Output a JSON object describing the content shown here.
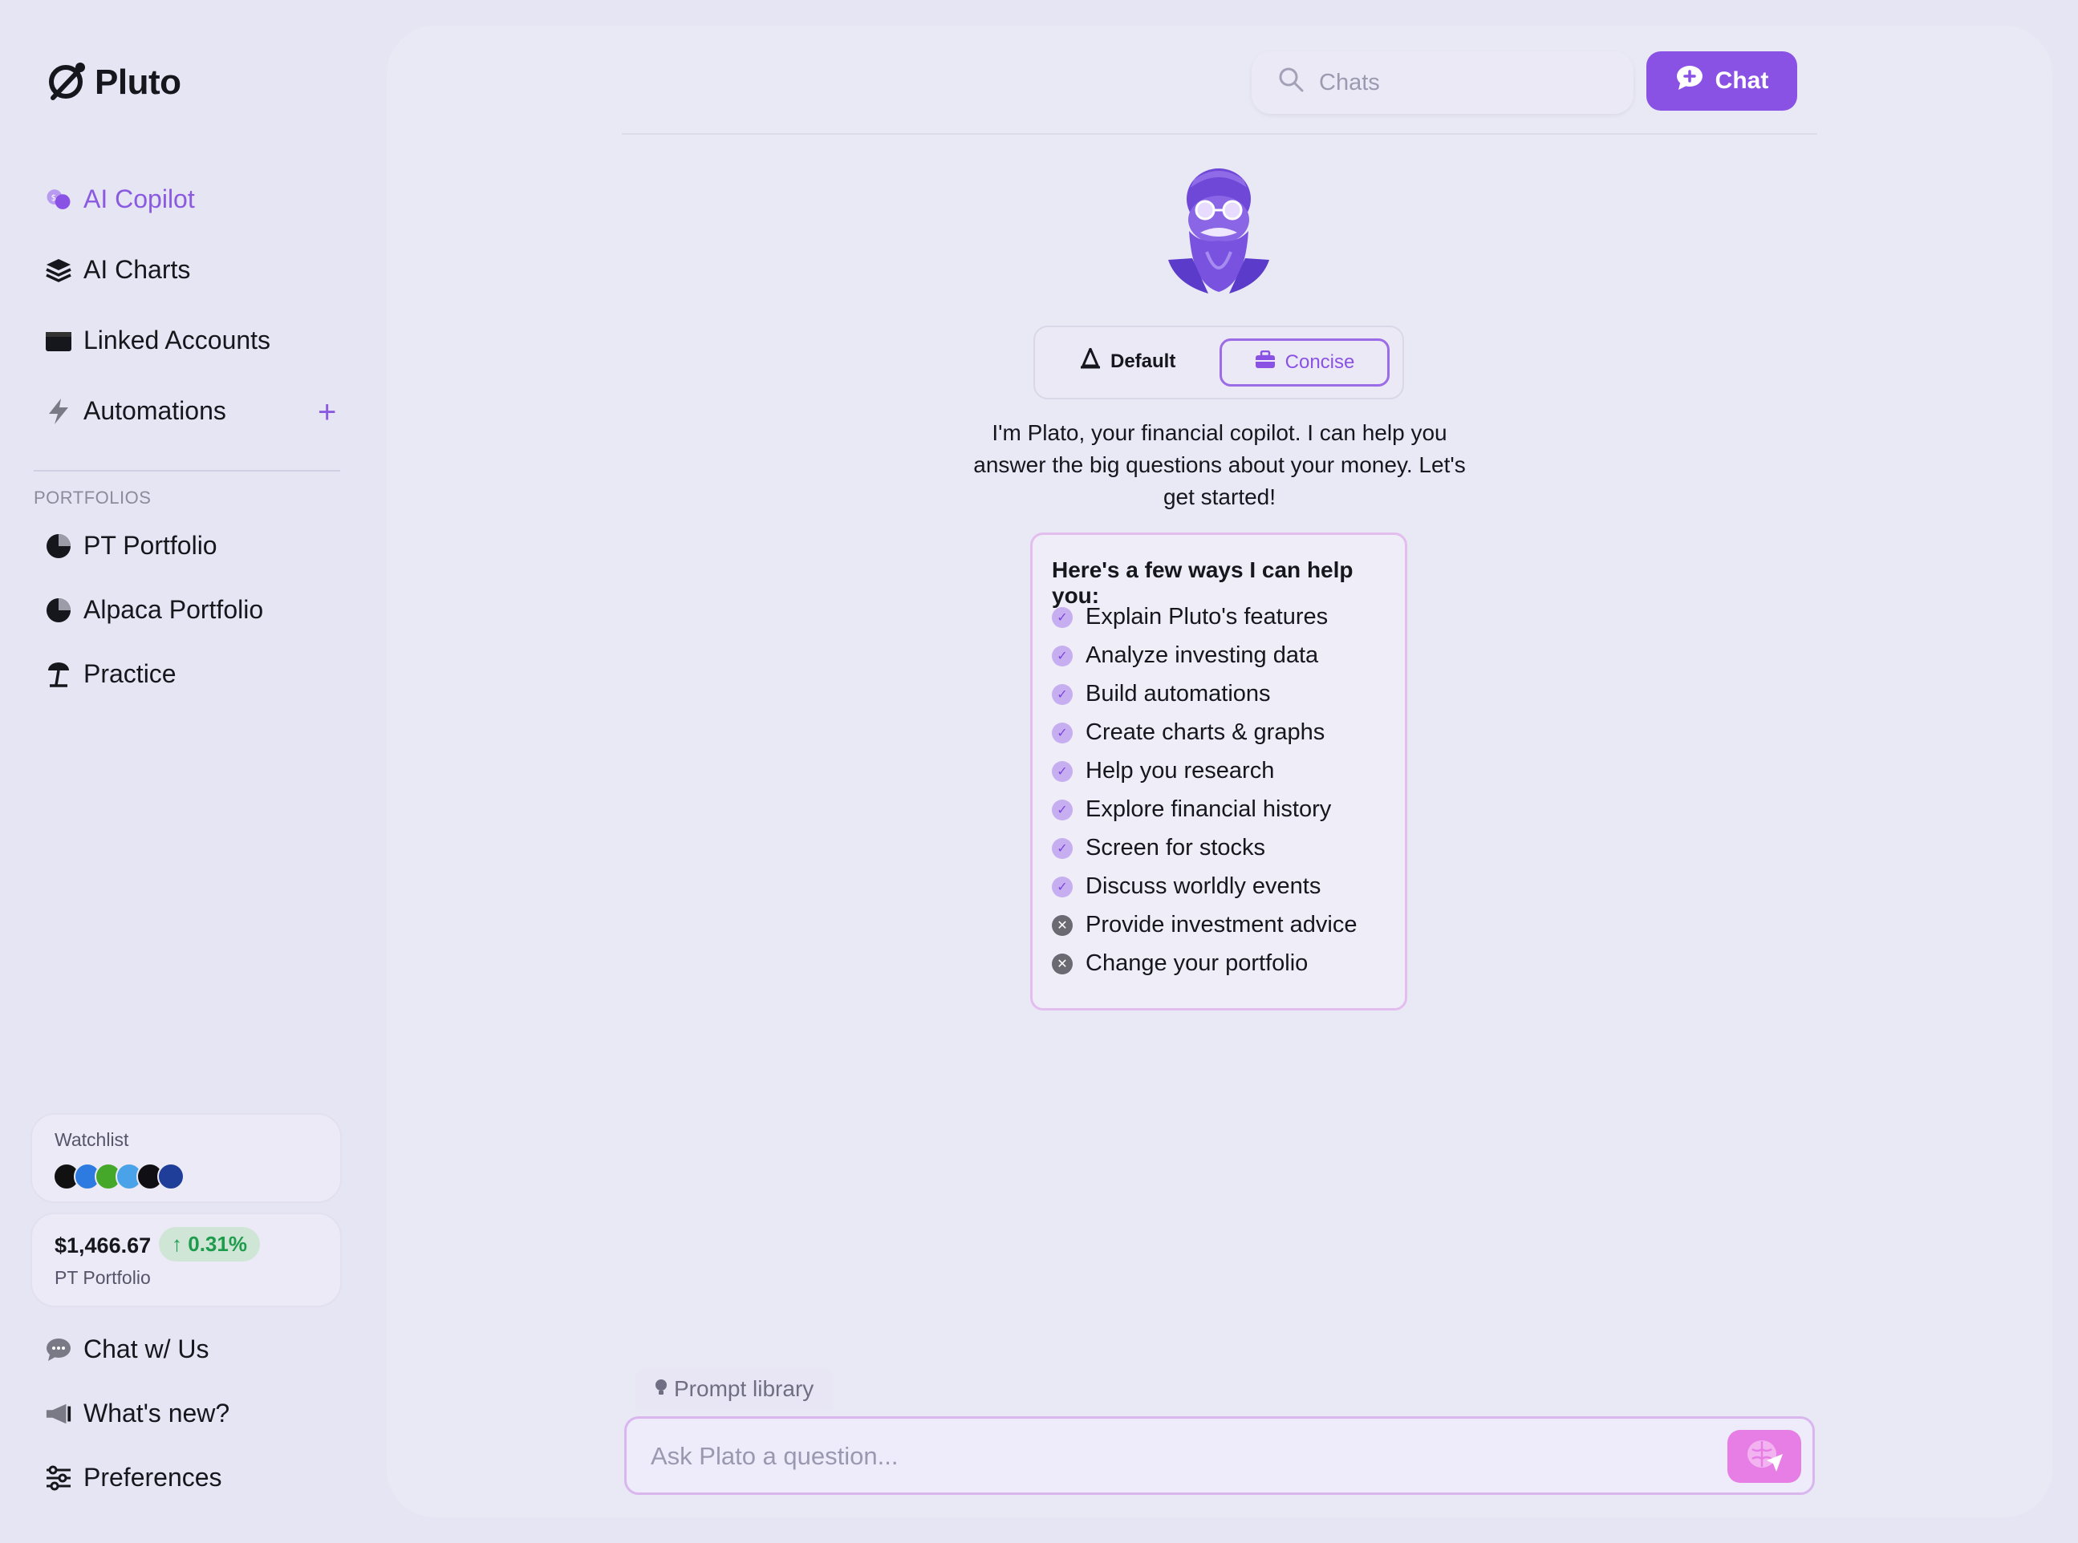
{
  "app": {
    "name": "Pluto"
  },
  "nav": {
    "ai_copilot": "AI Copilot",
    "ai_charts": "AI Charts",
    "linked_accounts": "Linked Accounts",
    "automations": "Automations",
    "add": "+"
  },
  "portfolios": {
    "section_label": "PORTFOLIOS",
    "items": [
      {
        "label": "PT Portfolio"
      },
      {
        "label": "Alpaca Portfolio"
      },
      {
        "label": "Practice"
      }
    ]
  },
  "watchlist": {
    "title": "Watchlist"
  },
  "portfolio_summary": {
    "value": "$1,466.67",
    "change": "0.31%",
    "label": "PT Portfolio"
  },
  "bottom_nav": {
    "chat_us": "Chat w/ Us",
    "whats_new": "What's new?",
    "preferences": "Preferences"
  },
  "header": {
    "search_placeholder": "Chats",
    "chat_button": "Chat"
  },
  "mode_toggle": {
    "default": "Default",
    "concise": "Concise",
    "selected": "Concise"
  },
  "intro_text": "I'm Plato, your financial copilot. I can help you answer the big questions about your money. Let's get started!",
  "help": {
    "title": "Here's a few ways I can help you:",
    "items": [
      {
        "label": "Explain Pluto's features",
        "ok": true
      },
      {
        "label": "Analyze investing data",
        "ok": true
      },
      {
        "label": "Build automations",
        "ok": true
      },
      {
        "label": "Create charts & graphs",
        "ok": true
      },
      {
        "label": "Help you research",
        "ok": true
      },
      {
        "label": "Explore financial history",
        "ok": true
      },
      {
        "label": "Screen for stocks",
        "ok": true
      },
      {
        "label": "Discuss worldly events",
        "ok": true
      },
      {
        "label": "Provide investment advice",
        "ok": false
      },
      {
        "label": "Change your portfolio",
        "ok": false
      }
    ]
  },
  "composer": {
    "prompt_library": "Prompt library",
    "placeholder": "Ask Plato a question..."
  },
  "colors": {
    "accent": "#8a52e4",
    "positive": "#1e9b4c",
    "send": "#e77ee6"
  }
}
